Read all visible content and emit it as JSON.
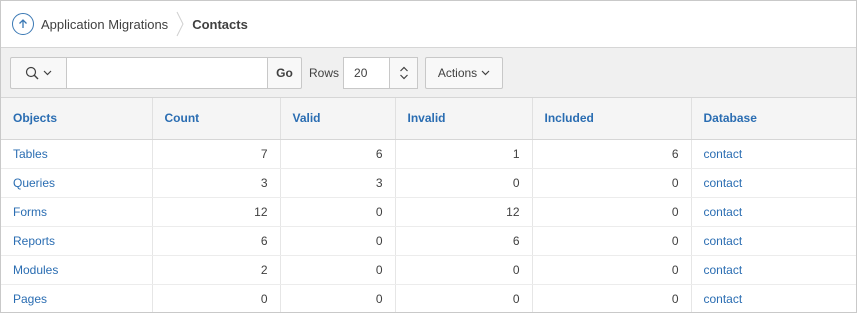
{
  "breadcrumb": {
    "parent": "Application Migrations",
    "current": "Contacts"
  },
  "toolbar": {
    "search_icon": "search-icon",
    "search_value": "",
    "go_label": "Go",
    "rows_label": "Rows",
    "rows_value": "20",
    "actions_label": "Actions"
  },
  "table": {
    "headers": [
      "Objects",
      "Count",
      "Valid",
      "Invalid",
      "Included",
      "Database"
    ],
    "rows": [
      [
        "Tables",
        "7",
        "6",
        "1",
        "6",
        "contact"
      ],
      [
        "Queries",
        "3",
        "3",
        "0",
        "0",
        "contact"
      ],
      [
        "Forms",
        "12",
        "0",
        "12",
        "0",
        "contact"
      ],
      [
        "Reports",
        "6",
        "0",
        "6",
        "0",
        "contact"
      ],
      [
        "Modules",
        "2",
        "0",
        "0",
        "0",
        "contact"
      ],
      [
        "Pages",
        "0",
        "0",
        "0",
        "0",
        "contact"
      ]
    ]
  },
  "colors": {
    "accent": "#2a6db2",
    "toolbar_bg": "#f0f0f0",
    "header_bg": "#f5f5f5"
  }
}
